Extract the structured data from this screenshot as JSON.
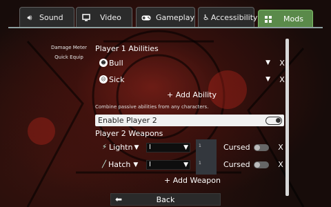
{
  "tabs": [
    {
      "label": "Sound",
      "icon": "speaker-icon"
    },
    {
      "label": "Video",
      "icon": "monitor-icon"
    },
    {
      "label": "Gameplay",
      "icon": "gamepad-icon"
    },
    {
      "label": "Accessibility",
      "icon": "wheelchair-icon"
    },
    {
      "label": "Mods",
      "icon": "mods-icon",
      "active": true
    }
  ],
  "side_menu": [
    "Damage Meter",
    "Quick Equip"
  ],
  "player1": {
    "heading": "Player 1 Abilities",
    "abilities": [
      {
        "name": "Bull"
      },
      {
        "name": "Sick"
      }
    ],
    "add_label": "+ Add Ability",
    "hint": "Combine passive abilities from any characters."
  },
  "toggle": {
    "label": "Enable Player 2",
    "on": true
  },
  "player2": {
    "heading": "Player 2 Weapons",
    "weapons": [
      {
        "name": "Lightn",
        "level": "I",
        "count": "1",
        "cursed_label": "Cursed"
      },
      {
        "name": "Hatch",
        "level": "I",
        "count": "1",
        "cursed_label": "Cursed"
      }
    ],
    "add_label": "+ Add Weapon"
  },
  "remove_label": "X",
  "back": {
    "label": "Back"
  },
  "colors": {
    "active_tab": "#5a8a4a",
    "panel_text": "#ffffff",
    "toggle_bg": "#f1f1f1"
  }
}
